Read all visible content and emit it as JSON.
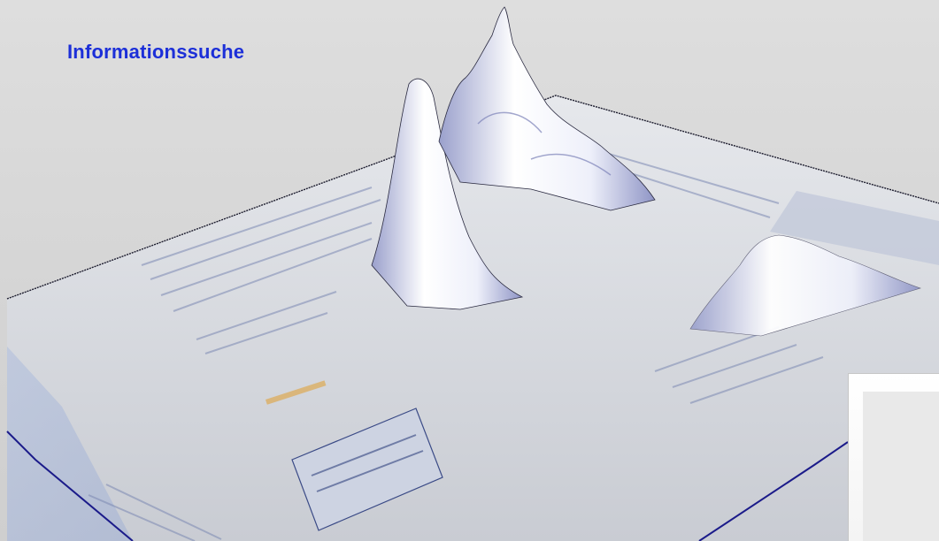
{
  "title": "Informationssuche",
  "colors": {
    "title": "#1c2fd8",
    "plane": "#cfd1d6",
    "plane_edge": "#1b1b8a",
    "peak": "#ffffff",
    "peak_shade": "#8a8fc8",
    "background": "#dcdcdc"
  },
  "heatmap_peaks": [
    {
      "name": "peak-top-left-results",
      "relative_height": 0.8
    },
    {
      "name": "peak-top-center-results",
      "relative_height": 1.0
    },
    {
      "name": "peak-right-sponsored",
      "relative_height": 0.35
    }
  ]
}
